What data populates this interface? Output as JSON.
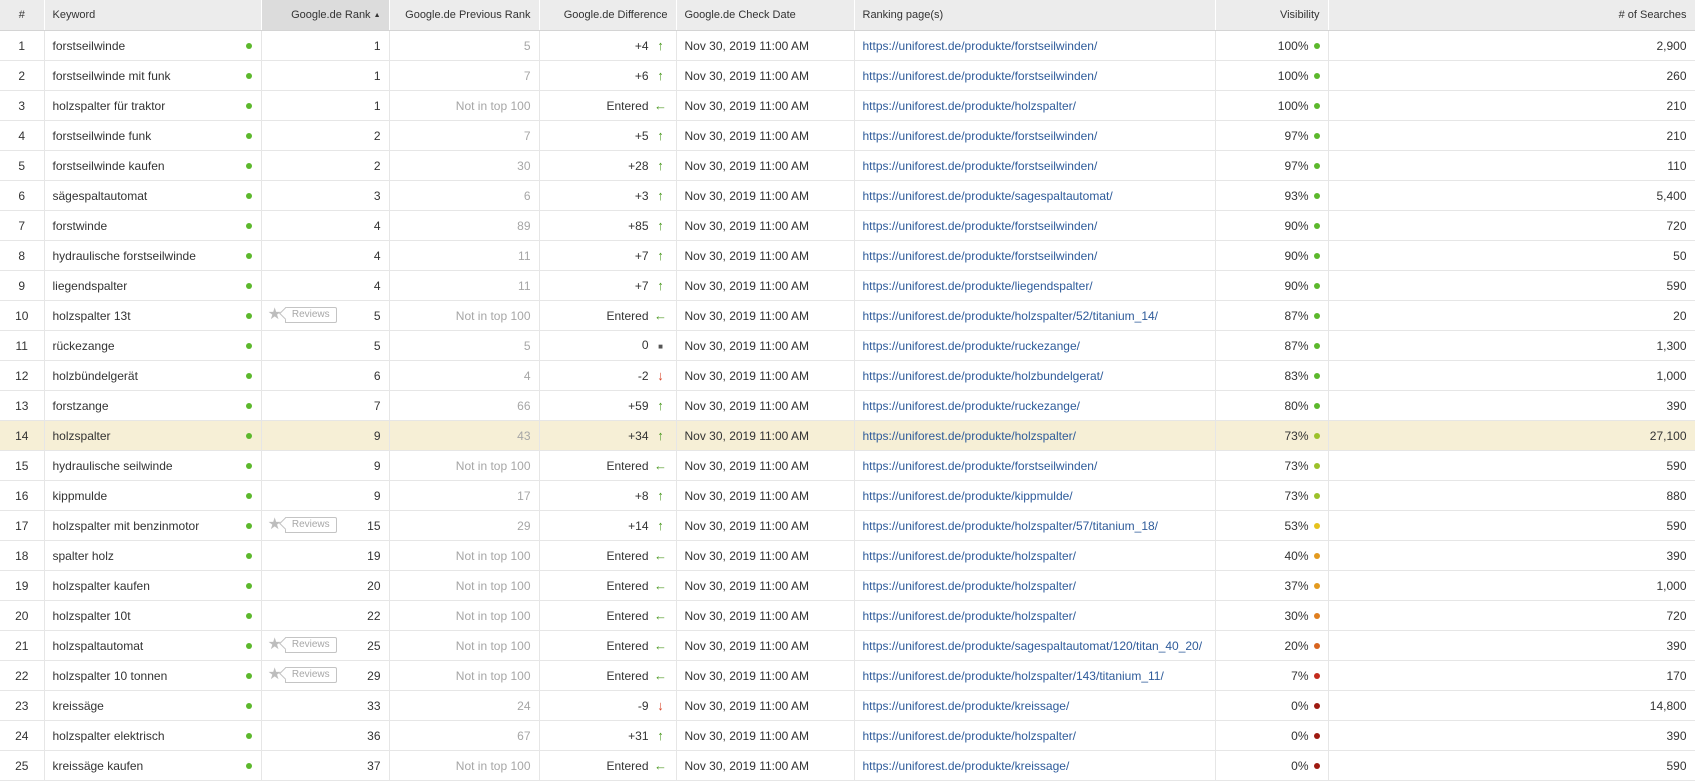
{
  "columns": {
    "num": "#",
    "keyword": "Keyword",
    "rank": "Google.de Rank",
    "prev_rank": "Google.de Previous Rank",
    "difference": "Google.de Difference",
    "check_date": "Google.de Check Date",
    "ranking_page": "Ranking page(s)",
    "visibility": "Visibility",
    "searches": "# of Searches"
  },
  "sort": {
    "column": "rank",
    "direction": "ascending",
    "icon": "sort-up-icon"
  },
  "reviews_label": "Reviews",
  "colors": {
    "green": "#5cb82c",
    "lime": "#9cc12a",
    "yellow": "#e6c21c",
    "orange": "#e39a1f",
    "dark_orange": "#d8641f",
    "red": "#c42b1c",
    "dark_red": "#9e1a10",
    "link": "#2e5b9a",
    "highlight_row": "#f6efd6"
  },
  "rows": [
    {
      "num": "1",
      "keyword": "forstseilwinde",
      "reviews": false,
      "rank": "1",
      "prev": "5",
      "diff": "+4",
      "trend": "up",
      "date": "Nov 30, 2019 11:00 AM",
      "url": "https://uniforest.de/produkte/forstseilwinden/",
      "vis": "100%",
      "vis_color": "#5cb82c",
      "searches": "2,900"
    },
    {
      "num": "2",
      "keyword": "forstseilwinde mit funk",
      "reviews": false,
      "rank": "1",
      "prev": "7",
      "diff": "+6",
      "trend": "up",
      "date": "Nov 30, 2019 11:00 AM",
      "url": "https://uniforest.de/produkte/forstseilwinden/",
      "vis": "100%",
      "vis_color": "#5cb82c",
      "searches": "260"
    },
    {
      "num": "3",
      "keyword": "holzspalter für traktor",
      "reviews": false,
      "rank": "1",
      "prev": "Not in top 100",
      "diff": "Entered",
      "trend": "entered",
      "date": "Nov 30, 2019 11:00 AM",
      "url": "https://uniforest.de/produkte/holzspalter/",
      "vis": "100%",
      "vis_color": "#5cb82c",
      "searches": "210"
    },
    {
      "num": "4",
      "keyword": "forstseilwinde funk",
      "reviews": false,
      "rank": "2",
      "prev": "7",
      "diff": "+5",
      "trend": "up",
      "date": "Nov 30, 2019 11:00 AM",
      "url": "https://uniforest.de/produkte/forstseilwinden/",
      "vis": "97%",
      "vis_color": "#5cb82c",
      "searches": "210"
    },
    {
      "num": "5",
      "keyword": "forstseilwinde kaufen",
      "reviews": false,
      "rank": "2",
      "prev": "30",
      "diff": "+28",
      "trend": "up",
      "date": "Nov 30, 2019 11:00 AM",
      "url": "https://uniforest.de/produkte/forstseilwinden/",
      "vis": "97%",
      "vis_color": "#5cb82c",
      "searches": "110"
    },
    {
      "num": "6",
      "keyword": "sägespaltautomat",
      "reviews": false,
      "rank": "3",
      "prev": "6",
      "diff": "+3",
      "trend": "up",
      "date": "Nov 30, 2019 11:00 AM",
      "url": "https://uniforest.de/produkte/sagespaltautomat/",
      "vis": "93%",
      "vis_color": "#5cb82c",
      "searches": "5,400"
    },
    {
      "num": "7",
      "keyword": "forstwinde",
      "reviews": false,
      "rank": "4",
      "prev": "89",
      "diff": "+85",
      "trend": "up",
      "date": "Nov 30, 2019 11:00 AM",
      "url": "https://uniforest.de/produkte/forstseilwinden/",
      "vis": "90%",
      "vis_color": "#5cb82c",
      "searches": "720"
    },
    {
      "num": "8",
      "keyword": "hydraulische forstseilwinde",
      "reviews": false,
      "rank": "4",
      "prev": "11",
      "diff": "+7",
      "trend": "up",
      "date": "Nov 30, 2019 11:00 AM",
      "url": "https://uniforest.de/produkte/forstseilwinden/",
      "vis": "90%",
      "vis_color": "#5cb82c",
      "searches": "50"
    },
    {
      "num": "9",
      "keyword": "liegendspalter",
      "reviews": false,
      "rank": "4",
      "prev": "11",
      "diff": "+7",
      "trend": "up",
      "date": "Nov 30, 2019 11:00 AM",
      "url": "https://uniforest.de/produkte/liegendspalter/",
      "vis": "90%",
      "vis_color": "#5cb82c",
      "searches": "590"
    },
    {
      "num": "10",
      "keyword": "holzspalter 13t",
      "reviews": true,
      "rank": "5",
      "prev": "Not in top 100",
      "diff": "Entered",
      "trend": "entered",
      "date": "Nov 30, 2019 11:00 AM",
      "url": "https://uniforest.de/produkte/holzspalter/52/titanium_14/",
      "vis": "87%",
      "vis_color": "#5cb82c",
      "searches": "20"
    },
    {
      "num": "11",
      "keyword": "rückezange",
      "reviews": false,
      "rank": "5",
      "prev": "5",
      "diff": "0",
      "trend": "same",
      "date": "Nov 30, 2019 11:00 AM",
      "url": "https://uniforest.de/produkte/ruckezange/",
      "vis": "87%",
      "vis_color": "#5cb82c",
      "searches": "1,300"
    },
    {
      "num": "12",
      "keyword": "holzbündelgerät",
      "reviews": false,
      "rank": "6",
      "prev": "4",
      "diff": "-2",
      "trend": "down",
      "date": "Nov 30, 2019 11:00 AM",
      "url": "https://uniforest.de/produkte/holzbundelgerat/",
      "vis": "83%",
      "vis_color": "#5cb82c",
      "searches": "1,000"
    },
    {
      "num": "13",
      "keyword": "forstzange",
      "reviews": false,
      "rank": "7",
      "prev": "66",
      "diff": "+59",
      "trend": "up",
      "date": "Nov 30, 2019 11:00 AM",
      "url": "https://uniforest.de/produkte/ruckezange/",
      "vis": "80%",
      "vis_color": "#5cb82c",
      "searches": "390"
    },
    {
      "num": "14",
      "keyword": "holzspalter",
      "reviews": false,
      "rank": "9",
      "prev": "43",
      "diff": "+34",
      "trend": "up",
      "date": "Nov 30, 2019 11:00 AM",
      "url": "https://uniforest.de/produkte/holzspalter/",
      "vis": "73%",
      "vis_color": "#9cc12a",
      "searches": "27,100",
      "highlight": true
    },
    {
      "num": "15",
      "keyword": "hydraulische seilwinde",
      "reviews": false,
      "rank": "9",
      "prev": "Not in top 100",
      "diff": "Entered",
      "trend": "entered",
      "date": "Nov 30, 2019 11:00 AM",
      "url": "https://uniforest.de/produkte/forstseilwinden/",
      "vis": "73%",
      "vis_color": "#9cc12a",
      "searches": "590"
    },
    {
      "num": "16",
      "keyword": "kippmulde",
      "reviews": false,
      "rank": "9",
      "prev": "17",
      "diff": "+8",
      "trend": "up",
      "date": "Nov 30, 2019 11:00 AM",
      "url": "https://uniforest.de/produkte/kippmulde/",
      "vis": "73%",
      "vis_color": "#9cc12a",
      "searches": "880"
    },
    {
      "num": "17",
      "keyword": "holzspalter mit benzinmotor",
      "reviews": true,
      "rank": "15",
      "prev": "29",
      "diff": "+14",
      "trend": "up",
      "date": "Nov 30, 2019 11:00 AM",
      "url": "https://uniforest.de/produkte/holzspalter/57/titanium_18/",
      "vis": "53%",
      "vis_color": "#e6c21c",
      "searches": "590"
    },
    {
      "num": "18",
      "keyword": "spalter holz",
      "reviews": false,
      "rank": "19",
      "prev": "Not in top 100",
      "diff": "Entered",
      "trend": "entered",
      "date": "Nov 30, 2019 11:00 AM",
      "url": "https://uniforest.de/produkte/holzspalter/",
      "vis": "40%",
      "vis_color": "#e39a1f",
      "searches": "390"
    },
    {
      "num": "19",
      "keyword": "holzspalter kaufen",
      "reviews": false,
      "rank": "20",
      "prev": "Not in top 100",
      "diff": "Entered",
      "trend": "entered",
      "date": "Nov 30, 2019 11:00 AM",
      "url": "https://uniforest.de/produkte/holzspalter/",
      "vis": "37%",
      "vis_color": "#e39a1f",
      "searches": "1,000"
    },
    {
      "num": "20",
      "keyword": "holzspalter 10t",
      "reviews": false,
      "rank": "22",
      "prev": "Not in top 100",
      "diff": "Entered",
      "trend": "entered",
      "date": "Nov 30, 2019 11:00 AM",
      "url": "https://uniforest.de/produkte/holzspalter/",
      "vis": "30%",
      "vis_color": "#e07f1f",
      "searches": "720"
    },
    {
      "num": "21",
      "keyword": "holzspaltautomat",
      "reviews": true,
      "rank": "25",
      "prev": "Not in top 100",
      "diff": "Entered",
      "trend": "entered",
      "date": "Nov 30, 2019 11:00 AM",
      "url": "https://uniforest.de/produkte/sagespaltautomat/120/titan_40_20/",
      "vis": "20%",
      "vis_color": "#d8641f",
      "searches": "390"
    },
    {
      "num": "22",
      "keyword": "holzspalter 10 tonnen",
      "reviews": true,
      "rank": "29",
      "prev": "Not in top 100",
      "diff": "Entered",
      "trend": "entered",
      "date": "Nov 30, 2019 11:00 AM",
      "url": "https://uniforest.de/produkte/holzspalter/143/titanium_11/",
      "vis": "7%",
      "vis_color": "#c42b1c",
      "searches": "170"
    },
    {
      "num": "23",
      "keyword": "kreissäge",
      "reviews": false,
      "rank": "33",
      "prev": "24",
      "diff": "-9",
      "trend": "down",
      "date": "Nov 30, 2019 11:00 AM",
      "url": "https://uniforest.de/produkte/kreissage/",
      "vis": "0%",
      "vis_color": "#9e1a10",
      "searches": "14,800"
    },
    {
      "num": "24",
      "keyword": "holzspalter elektrisch",
      "reviews": false,
      "rank": "36",
      "prev": "67",
      "diff": "+31",
      "trend": "up",
      "date": "Nov 30, 2019 11:00 AM",
      "url": "https://uniforest.de/produkte/holzspalter/",
      "vis": "0%",
      "vis_color": "#9e1a10",
      "searches": "390"
    },
    {
      "num": "25",
      "keyword": "kreissäge kaufen",
      "reviews": false,
      "rank": "37",
      "prev": "Not in top 100",
      "diff": "Entered",
      "trend": "entered",
      "date": "Nov 30, 2019 11:00 AM",
      "url": "https://uniforest.de/produkte/kreissage/",
      "vis": "0%",
      "vis_color": "#9e1a10",
      "searches": "590"
    }
  ]
}
